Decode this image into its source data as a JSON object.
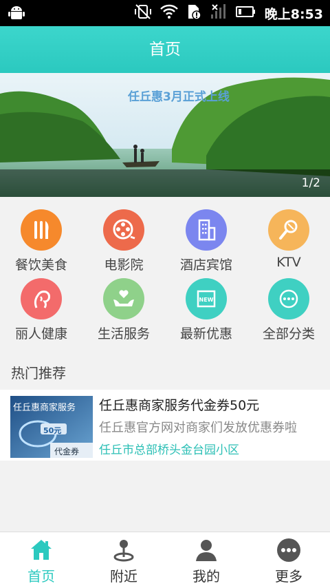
{
  "status_bar": {
    "time": "晚上8:53",
    "icons": [
      "android-icon",
      "vibrate-off-icon",
      "wifi-icon",
      "sim-alert-icon",
      "signal-icon",
      "battery-icon"
    ]
  },
  "header": {
    "title": "首页"
  },
  "banner": {
    "caption": "任丘惠3月正式上线",
    "pager": "1/2"
  },
  "categories": [
    {
      "label": "餐饮美食",
      "icon": "utensils-icon",
      "color": "#f6892c"
    },
    {
      "label": "电影院",
      "icon": "film-reel-icon",
      "color": "#ed6a4b"
    },
    {
      "label": "酒店宾馆",
      "icon": "building-icon",
      "color": "#7b86ef"
    },
    {
      "label": "KTV",
      "icon": "microphone-icon",
      "color": "#f6b55a"
    },
    {
      "label": "丽人健康",
      "icon": "woman-profile-icon",
      "color": "#f36b6b"
    },
    {
      "label": "生活服务",
      "icon": "heart-hands-icon",
      "color": "#8fd18a"
    },
    {
      "label": "最新优惠",
      "icon": "new-badge-icon",
      "color": "#3fd0c2"
    },
    {
      "label": "全部分类",
      "icon": "more-dots-icon",
      "color": "#3fd0c2"
    }
  ],
  "section": {
    "title": "热门推荐"
  },
  "recommendations": [
    {
      "title": "任丘惠商家服务代金券50元",
      "description": "任丘惠官方网对商家们发放优惠券啦",
      "address": "任丘市总部桥头金台园小区",
      "thumb_text_top": "任丘惠商家服务",
      "thumb_text_value": "50元",
      "thumb_text_bottom": "代金券"
    }
  ],
  "bottom_nav": [
    {
      "label": "首页",
      "icon": "home-icon",
      "active": true
    },
    {
      "label": "附近",
      "icon": "location-pin-icon",
      "active": false
    },
    {
      "label": "我的",
      "icon": "user-icon",
      "active": false
    },
    {
      "label": "更多",
      "icon": "more-dots-icon",
      "active": false
    }
  ],
  "colors": {
    "accent": "#2bc9bf",
    "status_bar": "#000000"
  }
}
